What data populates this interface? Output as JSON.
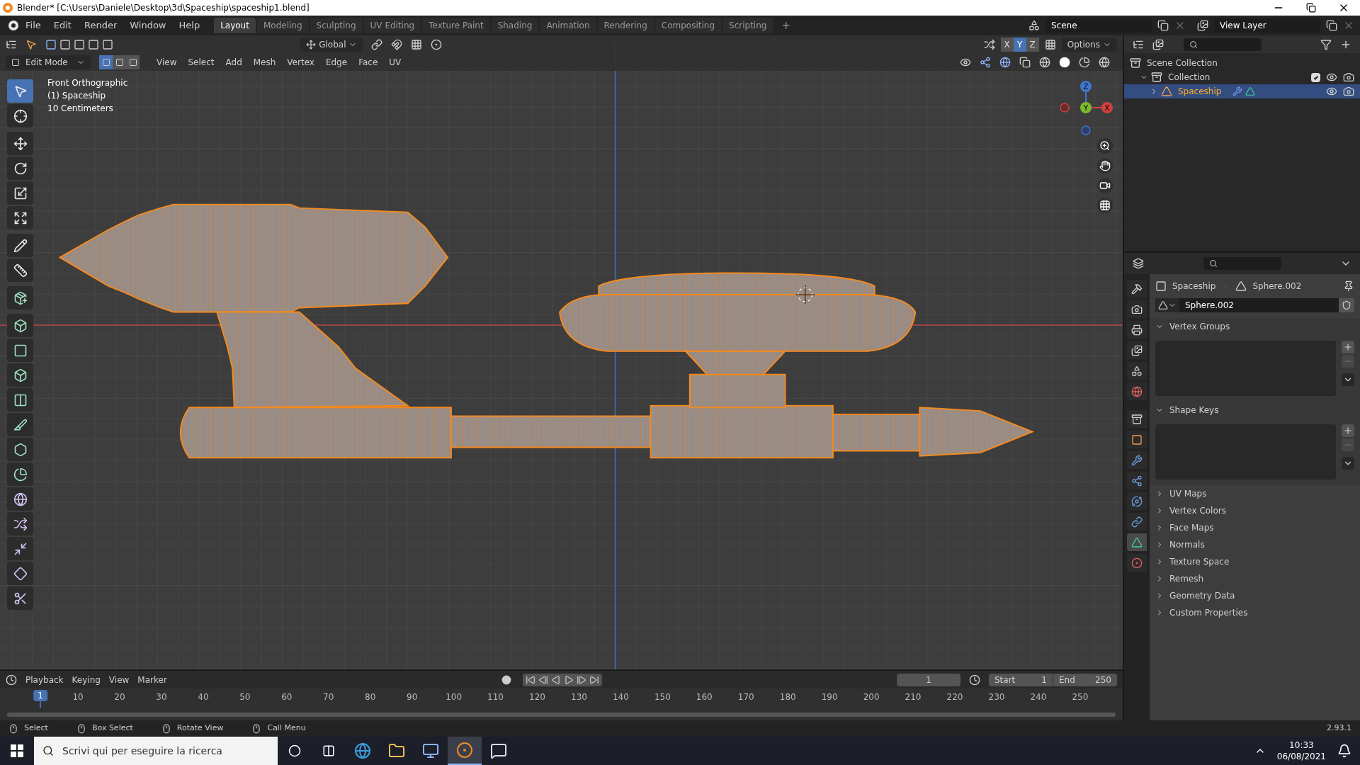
{
  "window": {
    "title": "Blender* [C:\\Users\\Daniele\\Desktop\\3d\\Spaceship\\spaceship1.blend]"
  },
  "menu": [
    "File",
    "Edit",
    "Render",
    "Window",
    "Help"
  ],
  "workspaces": [
    {
      "label": "Layout",
      "selected": true
    },
    {
      "label": "Modeling",
      "selected": false
    },
    {
      "label": "Sculpting",
      "selected": false
    },
    {
      "label": "UV Editing",
      "selected": false
    },
    {
      "label": "Texture Paint",
      "selected": false
    },
    {
      "label": "Shading",
      "selected": false
    },
    {
      "label": "Animation",
      "selected": false
    },
    {
      "label": "Rendering",
      "selected": false
    },
    {
      "label": "Compositing",
      "selected": false
    },
    {
      "label": "Scripting",
      "selected": false
    }
  ],
  "add_workspace": "+",
  "scene": "Scene",
  "view_layer": "View Layer",
  "transform_orientation": "Global",
  "axes": [
    {
      "label": "X",
      "selected": false
    },
    {
      "label": "Y",
      "selected": true
    },
    {
      "label": "Z",
      "selected": false
    }
  ],
  "options": "Options",
  "mode": "Edit Mode",
  "select_modes": [
    {
      "selected": true
    },
    {
      "selected": false
    },
    {
      "selected": false
    }
  ],
  "editor_menu": [
    "View",
    "Select",
    "Add",
    "Mesh",
    "Vertex",
    "Edge",
    "Face",
    "UV"
  ],
  "overlay_text": [
    "Front Orthographic",
    "(1) Spaceship",
    "10 Centimeters"
  ],
  "gizmo": [
    "Z",
    "Y",
    "X"
  ],
  "tools": [
    {
      "selected": true
    },
    {
      "selected": false
    },
    {
      "selected": false
    },
    {
      "selected": false
    },
    {
      "selected": false
    },
    {
      "selected": false
    },
    {
      "selected": false
    },
    {
      "selected": false
    },
    {
      "selected": false
    },
    {
      "selected": false
    },
    {
      "selected": false
    },
    {
      "selected": false
    },
    {
      "selected": false
    },
    {
      "selected": false
    },
    {
      "selected": false
    },
    {
      "selected": false
    },
    {
      "selected": false
    },
    {
      "selected": false
    },
    {
      "selected": false
    },
    {
      "selected": false
    },
    {
      "selected": false
    }
  ],
  "outliner": {
    "items": [
      {
        "label": "Scene Collection",
        "children": [
          {
            "label": "Collection",
            "expanded": true,
            "checked": true,
            "children": [
              {
                "label": "Spaceship",
                "expanded": false,
                "selected": true
              }
            ]
          }
        ]
      }
    ]
  },
  "properties": {
    "object": "Spaceship",
    "data": "Sphere.002",
    "mesh_name": "Sphere.002",
    "tabs": [
      {
        "selected": false
      },
      {
        "selected": false
      },
      {
        "selected": false
      },
      {
        "selected": false
      },
      {
        "selected": false
      },
      {
        "selected": false
      },
      {
        "selected": false
      },
      {
        "selected": false
      },
      {
        "selected": false
      },
      {
        "selected": false
      },
      {
        "selected": false
      },
      {
        "selected": false
      },
      {
        "selected": true
      },
      {
        "selected": false
      }
    ],
    "panels": [
      {
        "label": "Vertex Groups",
        "expanded": true
      },
      {
        "label": "Shape Keys",
        "expanded": true
      },
      {
        "label": "UV Maps",
        "expanded": false
      },
      {
        "label": "Vertex Colors",
        "expanded": false
      },
      {
        "label": "Face Maps",
        "expanded": false
      },
      {
        "label": "Normals",
        "expanded": false
      },
      {
        "label": "Texture Space",
        "expanded": false
      },
      {
        "label": "Remesh",
        "expanded": false
      },
      {
        "label": "Geometry Data",
        "expanded": false
      },
      {
        "label": "Custom Properties",
        "expanded": false
      }
    ]
  },
  "timeline": {
    "menus": [
      "Playback",
      "Keying",
      "View",
      "Marker"
    ],
    "current_frame": "1",
    "start_label": "Start",
    "start": "1",
    "end_label": "End",
    "end": "250",
    "playhead": "1",
    "ticks": [
      "10",
      "20",
      "30",
      "40",
      "50",
      "60",
      "70",
      "80",
      "90",
      "100",
      "110",
      "120",
      "130",
      "140",
      "150",
      "160",
      "170",
      "180",
      "190",
      "200",
      "210",
      "220",
      "230",
      "240",
      "250"
    ]
  },
  "status_bar": {
    "hints": [
      "Select",
      "Box Select",
      "Rotate View",
      "Call Menu"
    ],
    "version": "2.93.1"
  },
  "taskbar": {
    "search_placeholder": "Scrivi qui per eseguire la ricerca",
    "apps": [
      {
        "selected": false
      },
      {
        "selected": false
      },
      {
        "selected": false
      },
      {
        "selected": true
      },
      {
        "selected": false
      }
    ],
    "time": "10:33",
    "date": "06/08/2021"
  }
}
